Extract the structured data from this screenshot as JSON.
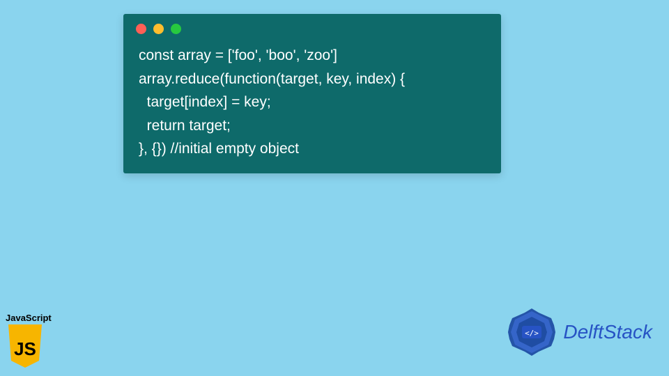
{
  "code": {
    "lines": [
      "const array = ['foo', 'boo', 'zoo']",
      "array.reduce(function(target, key, index) {",
      "  target[index] = key;",
      "  return target;",
      "}, {}) //initial empty object"
    ]
  },
  "js_badge": {
    "label": "JavaScript",
    "shield_text": "JS"
  },
  "brand": {
    "name": "DelftStack"
  },
  "colors": {
    "bg": "#8ad4ee",
    "window": "#0e6a6a",
    "js_yellow": "#f7b500",
    "brand_blue": "#2753c4"
  }
}
